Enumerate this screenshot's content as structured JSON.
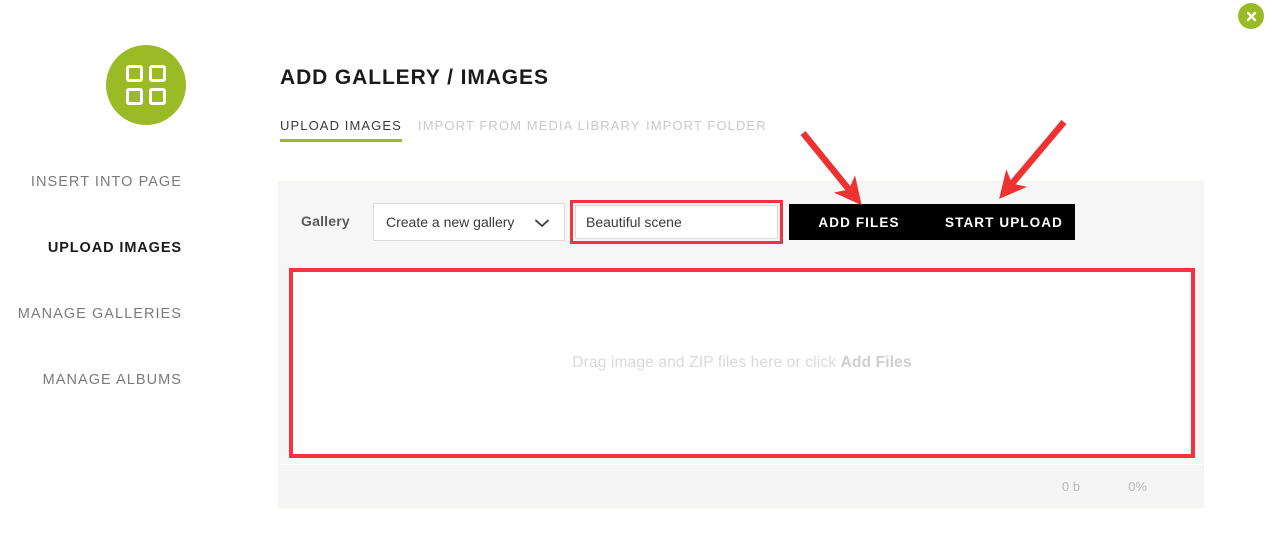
{
  "window": {
    "close_label": "×",
    "close_icon": "close-circle-icon",
    "accent_green": "#9ABB26",
    "annotation_red": "#F5333F"
  },
  "sidebar": {
    "logo_icon": "grid-squares-logo-icon",
    "items": [
      {
        "label": "INSERT INTO PAGE",
        "active": false
      },
      {
        "label": "UPLOAD IMAGES",
        "active": true
      },
      {
        "label": "MANAGE GALLERIES",
        "active": false
      },
      {
        "label": "MANAGE ALBUMS",
        "active": false
      }
    ]
  },
  "main": {
    "title": "ADD GALLERY / IMAGES",
    "tabs": [
      {
        "label": "UPLOAD IMAGES",
        "active": true
      },
      {
        "label": "IMPORT FROM MEDIA LIBRARY",
        "active": false
      },
      {
        "label": "IMPORT FOLDER",
        "active": false
      }
    ],
    "form": {
      "gallery_label": "Gallery",
      "gallery_select_value": "Create a new gallery",
      "gallery_select_options": [
        "Create a new gallery"
      ],
      "chevron_icon": "chevron-down-icon",
      "name_value": "Beautiful scene",
      "name_placeholder": "",
      "add_files_label": "Add Files",
      "start_upload_label": "Start Upload"
    },
    "dropzone": {
      "text_lead": "Drag image and ZIP files here or click ",
      "text_strong": "Add Files"
    },
    "footer": {
      "size": "0 b",
      "percent": "0%"
    }
  }
}
